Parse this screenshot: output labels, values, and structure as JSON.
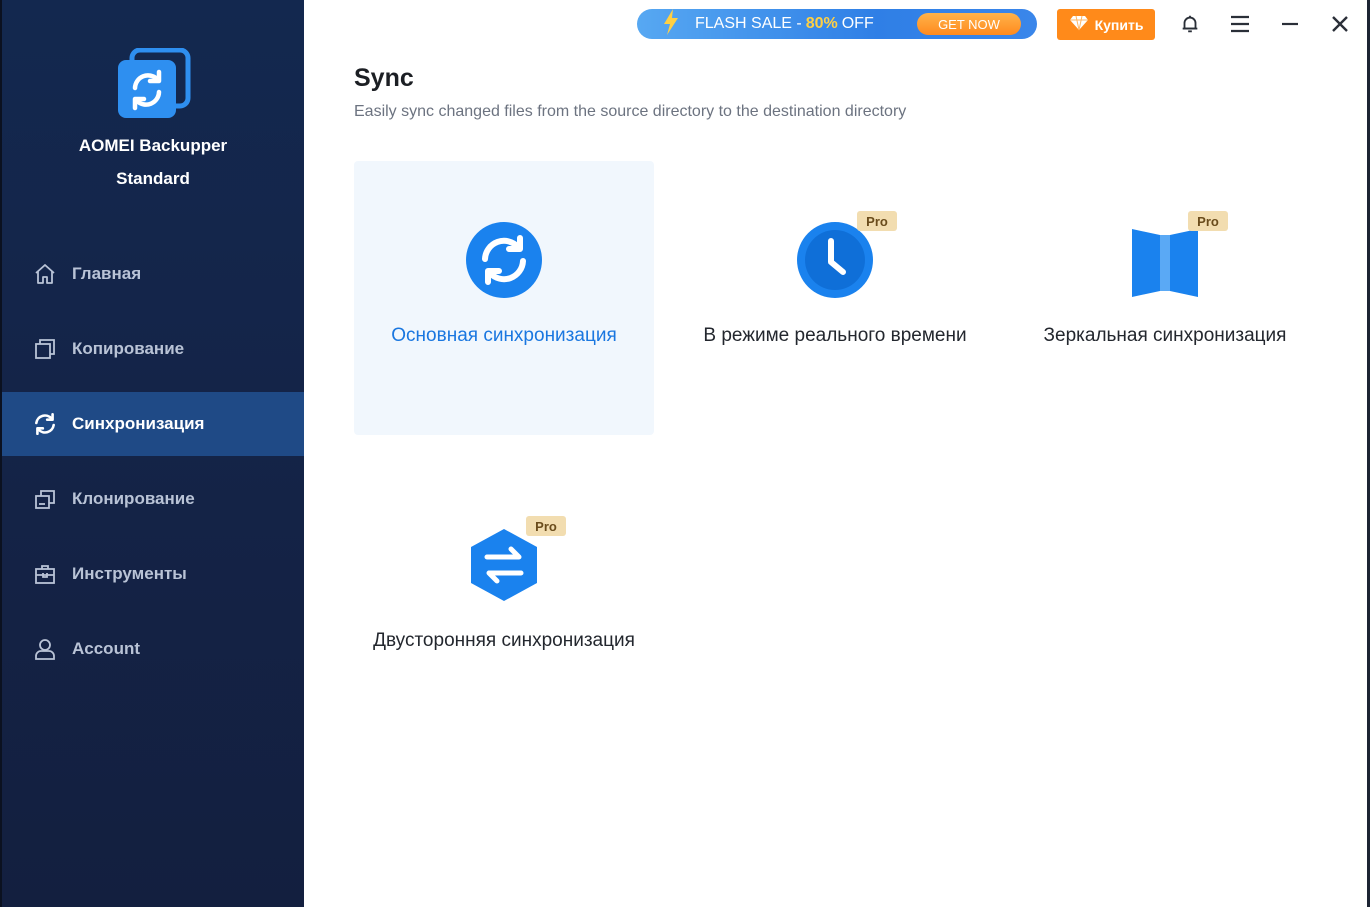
{
  "app": {
    "name": "AOMEI Backupper",
    "edition": "Standard"
  },
  "nav": {
    "items": [
      {
        "label": "Главная",
        "icon": "home-icon"
      },
      {
        "label": "Копирование",
        "icon": "copy-icon"
      },
      {
        "label": "Синхронизация",
        "icon": "sync-icon"
      },
      {
        "label": "Клонирование",
        "icon": "clone-icon"
      },
      {
        "label": "Инструменты",
        "icon": "toolbox-icon"
      },
      {
        "label": "Account",
        "icon": "user-icon"
      }
    ],
    "active_label": "Синхронизация"
  },
  "topbar": {
    "flash_prefix": "FLASH SALE -",
    "flash_percent": "80%",
    "flash_suffix": "OFF",
    "get_now": "GET NOW",
    "buy_label": "Купить"
  },
  "page": {
    "title": "Sync",
    "subtitle": "Easily sync changed files from the source directory to the destination directory"
  },
  "options": [
    {
      "label": "Основная синхронизация",
      "icon": "basic-sync-icon",
      "pro": "",
      "selected": true
    },
    {
      "label": "В режиме реального времени",
      "icon": "clock-icon",
      "pro": "Pro",
      "selected": false
    },
    {
      "label": "Зеркальная синхронизация",
      "icon": "mirror-icon",
      "pro": "Pro",
      "selected": false
    },
    {
      "label": "Двусторонняя синхронизация",
      "icon": "two-way-sync-icon",
      "pro": "Pro",
      "selected": false
    }
  ],
  "colors": {
    "sidebar": "#13284f",
    "active_nav": "#1f4a86",
    "accent": "#1a77e0",
    "buy": "#ff8a1a",
    "pro_badge": "#f2ddb0"
  }
}
